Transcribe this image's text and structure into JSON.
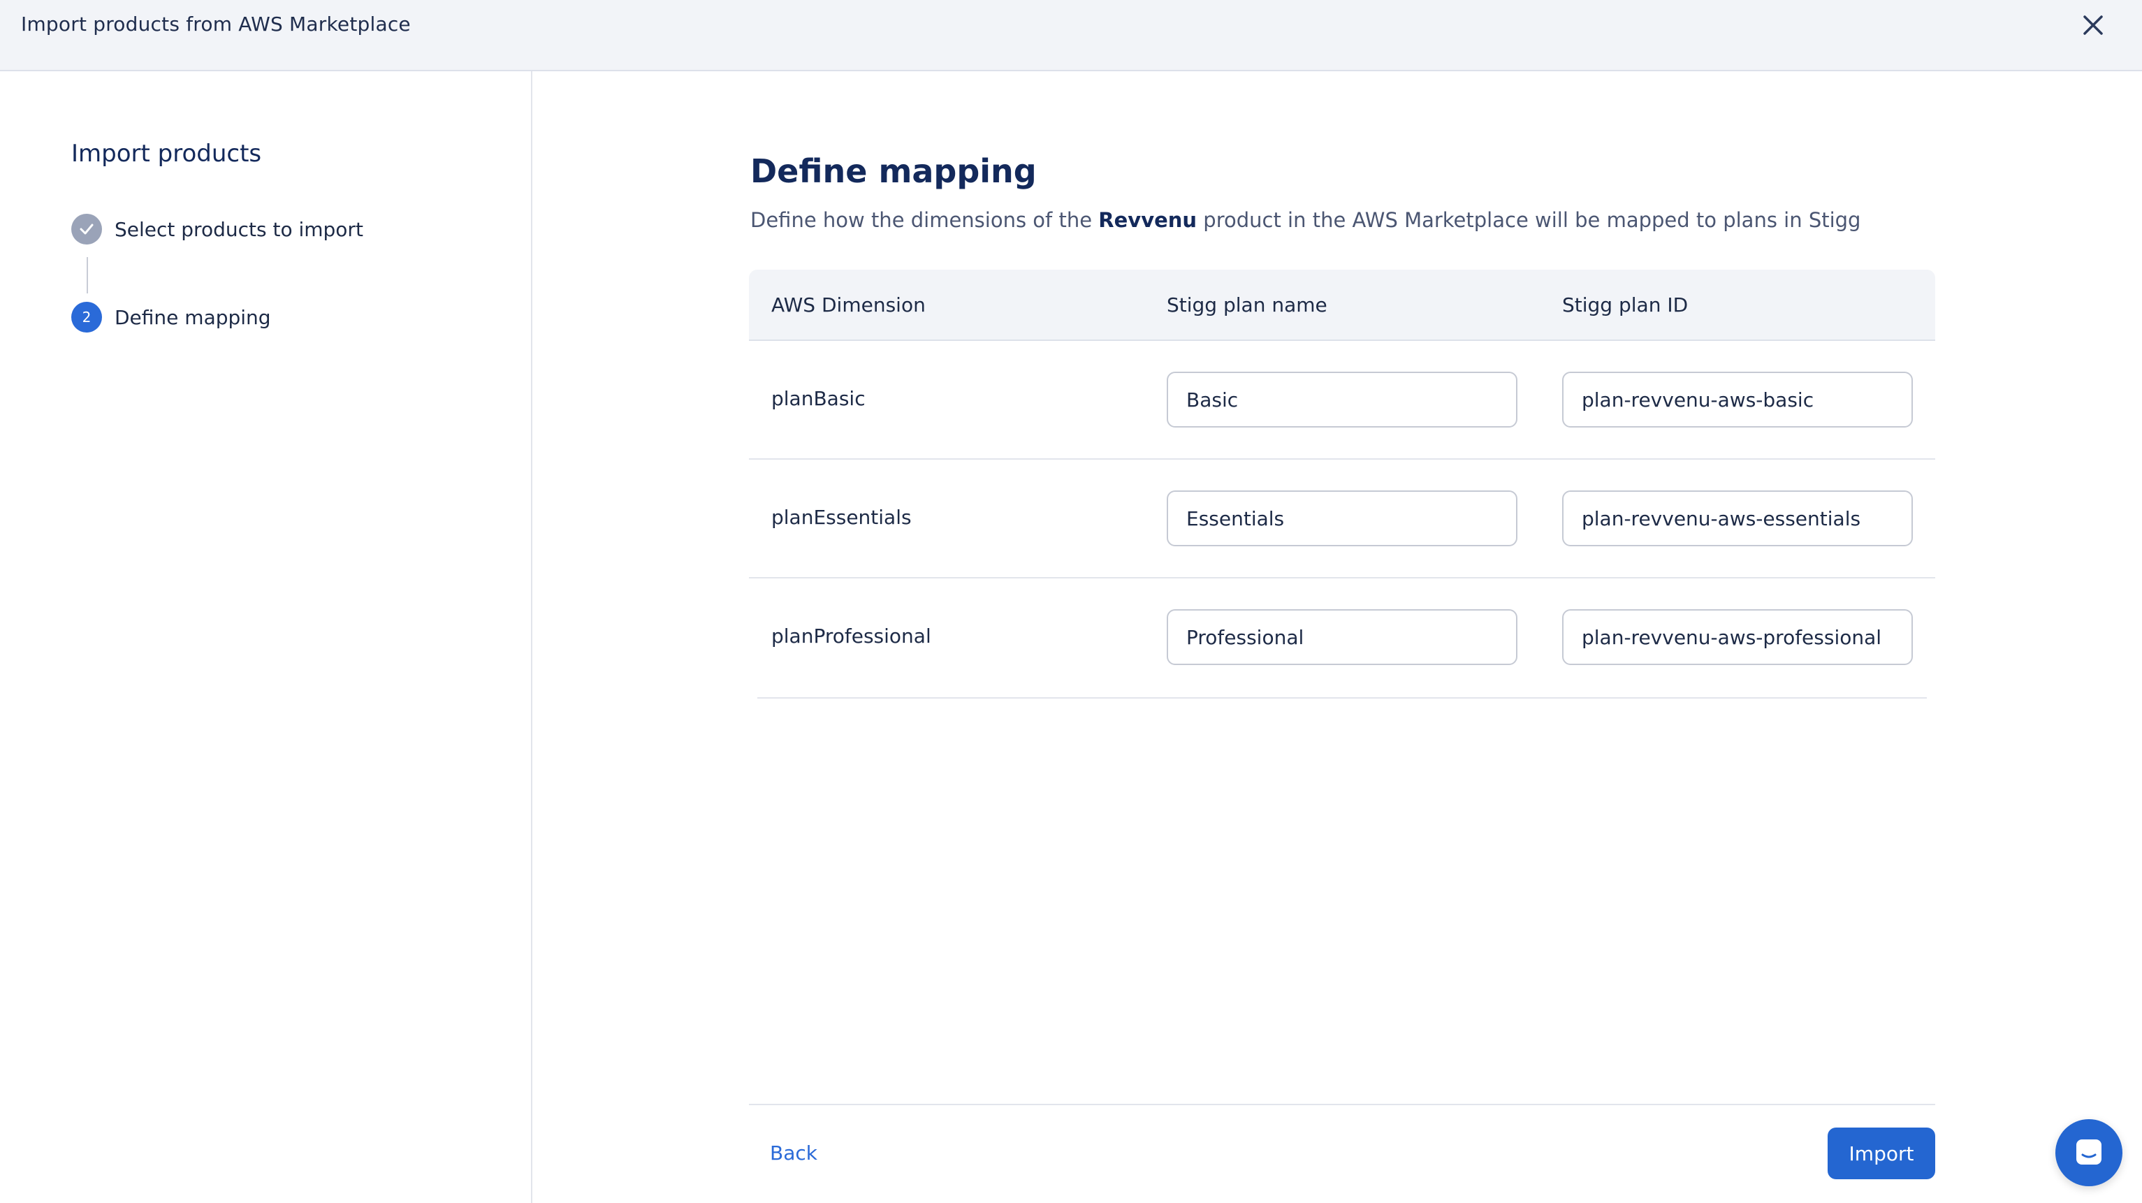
{
  "header": {
    "title": "Import products from AWS Marketplace"
  },
  "sidebar": {
    "title": "Import products",
    "steps": [
      {
        "number": "",
        "label": "Select products to import",
        "status": "completed"
      },
      {
        "number": "2",
        "label": "Define mapping",
        "status": "active"
      }
    ]
  },
  "main": {
    "title": "Define mapping",
    "description_prefix": "Define how the dimensions of the",
    "product_name": "Revvenu",
    "description_suffix": "product in the AWS Marketplace will be mapped to plans in Stigg",
    "table": {
      "columns": [
        "AWS Dimension",
        "Stigg plan name",
        "Stigg plan ID"
      ],
      "rows": [
        {
          "dimension": "planBasic",
          "plan_name": "Basic",
          "plan_id": "plan-revvenu-aws-basic"
        },
        {
          "dimension": "planEssentials",
          "plan_name": "Essentials",
          "plan_id": "plan-revvenu-aws-essentials"
        },
        {
          "dimension": "planProfessional",
          "plan_name": "Professional",
          "plan_id": "plan-revvenu-aws-professional"
        }
      ]
    }
  },
  "footer": {
    "back_label": "Back",
    "import_label": "Import"
  },
  "colors": {
    "accent": "#2466d1",
    "heading": "#13295b",
    "completed_step": "#9aa3b8"
  },
  "icons": {
    "close": "close-icon",
    "check": "check-icon",
    "chat": "chat-icon"
  }
}
